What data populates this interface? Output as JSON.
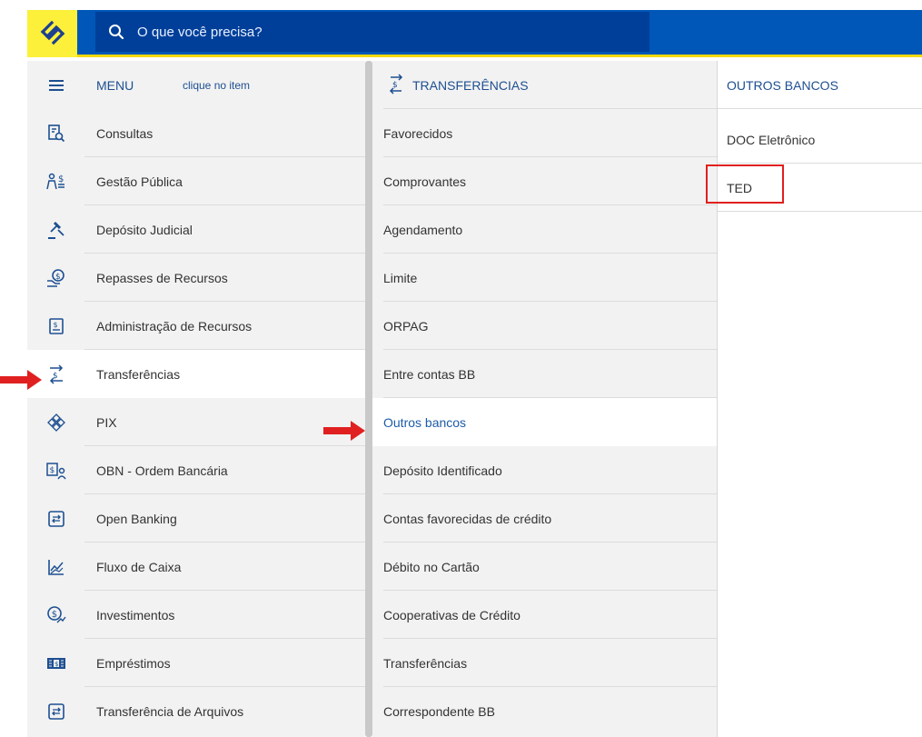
{
  "search": {
    "placeholder": "O que você precisa?"
  },
  "menu": {
    "header_label": "MENU",
    "header_hint": "clique no item",
    "items": [
      {
        "label": "Consultas",
        "icon": "document-search-icon"
      },
      {
        "label": "Gestão Pública",
        "icon": "people-money-icon"
      },
      {
        "label": "Depósito Judicial",
        "icon": "gavel-icon"
      },
      {
        "label": "Repasses de Recursos",
        "icon": "hand-money-icon"
      },
      {
        "label": "Administração de Recursos",
        "icon": "money-document-icon"
      },
      {
        "label": "Transferências",
        "icon": "transfer-arrows-icon",
        "active": true
      },
      {
        "label": "PIX",
        "icon": "pix-icon"
      },
      {
        "label": "OBN - Ordem Bancária",
        "icon": "money-person-icon"
      },
      {
        "label": "Open Banking",
        "icon": "exchange-box-icon"
      },
      {
        "label": "Fluxo de Caixa",
        "icon": "chart-line-icon"
      },
      {
        "label": "Investimentos",
        "icon": "coin-growth-icon"
      },
      {
        "label": "Empréstimos",
        "icon": "banknote-icon"
      },
      {
        "label": "Transferência de Arquivos",
        "icon": "exchange-box-icon"
      }
    ]
  },
  "submenu": {
    "header_label": "TRANSFERÊNCIAS",
    "items": [
      {
        "label": "Favorecidos"
      },
      {
        "label": "Comprovantes"
      },
      {
        "label": "Agendamento"
      },
      {
        "label": "Limite"
      },
      {
        "label": "ORPAG"
      },
      {
        "label": "Entre contas BB"
      },
      {
        "label": "Outros bancos",
        "active": true
      },
      {
        "label": "Depósito Identificado"
      },
      {
        "label": "Contas favorecidas de crédito"
      },
      {
        "label": "Débito no Cartão"
      },
      {
        "label": "Cooperativas de Crédito"
      },
      {
        "label": "Transferências"
      },
      {
        "label": "Correspondente BB"
      }
    ]
  },
  "third": {
    "header_label": "OUTROS BANCOS",
    "items": [
      {
        "label": "DOC Eletrônico"
      },
      {
        "label": "TED",
        "highlighted": true
      }
    ]
  },
  "colors": {
    "brand_blue": "#0057b8",
    "brand_yellow": "#fcf03b",
    "link_blue": "#1d5ba8",
    "annotation_red": "#e02020"
  }
}
